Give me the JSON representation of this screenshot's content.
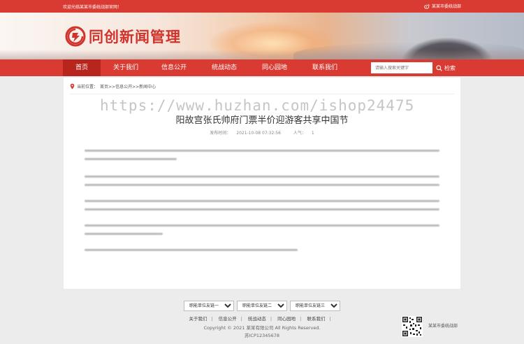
{
  "topbar": {
    "welcome": "欢迎光临某某市委统战部官网！",
    "right_link": "某某市委统战部"
  },
  "brand": {
    "logo_text": "同创新闻管理",
    "accent": "#d93a31"
  },
  "nav": {
    "items": [
      {
        "label": "首页",
        "active": true
      },
      {
        "label": "关于我们"
      },
      {
        "label": "信息公开"
      },
      {
        "label": "统战动态"
      },
      {
        "label": "同心园地"
      },
      {
        "label": "联系我们"
      }
    ],
    "search_placeholder": "请输入搜索关键字",
    "search_label": "检索"
  },
  "breadcrumb": {
    "prefix": "当前位置：",
    "path": "首页>>信息公开>>新闻中心"
  },
  "article": {
    "title": "阳故宫张氏帅府门票半价迎游客共享中国节",
    "publish_label": "发布时间：",
    "publish_time": "2021-10-08 07:32:56",
    "views_label": "人气：",
    "views": "1"
  },
  "watermark": "https://www.huzhan.com/ishop24475",
  "friend_links": [
    "职能单位友链一",
    "职能单位友链二",
    "职能单位友链三"
  ],
  "footer": {
    "links": [
      "关于我们",
      "信息公开",
      "统战动态",
      "同心园地",
      "联系我们"
    ],
    "copyright": "Copyright © 2021 某某有限公司 All Rights Reserved.",
    "icp": "苏ICP12345678",
    "qr_label": "某某市委统战部"
  }
}
